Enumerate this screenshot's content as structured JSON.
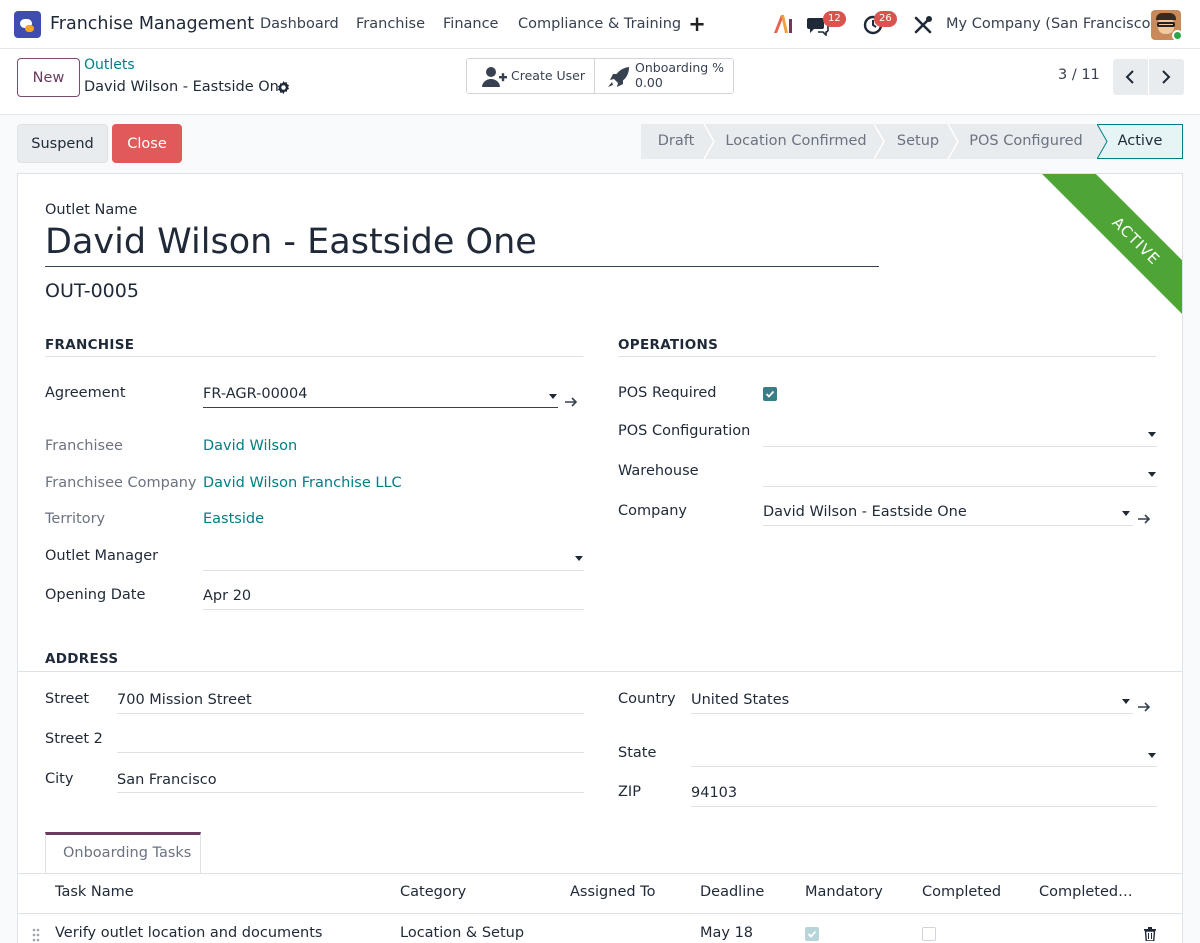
{
  "navbar": {
    "app_title": "Franchise Management",
    "menu": [
      "Dashboard",
      "Franchise",
      "Finance",
      "Compliance & Training"
    ],
    "messages_count": "12",
    "activities_count": "26",
    "company": "My Company (San Francisco)"
  },
  "control": {
    "new_label": "New",
    "breadcrumb_parent": "Outlets",
    "breadcrumb_current": "David Wilson - Eastside One",
    "create_user_label": "Create User",
    "onboarding_label": "Onboarding %",
    "onboarding_value": "0.00",
    "pager_value": "3 / 11"
  },
  "actions": {
    "suspend_label": "Suspend",
    "close_label": "Close"
  },
  "status": {
    "stages": [
      "Draft",
      "Location Confirmed",
      "Setup",
      "POS Configured",
      "Active"
    ],
    "current": "Active"
  },
  "ribbon": "ACTIVE",
  "form": {
    "outlet_name_label": "Outlet Name",
    "outlet_name": "David Wilson - Eastside One",
    "code": "OUT-0005",
    "franchise_section": "FRANCHISE",
    "operations_section": "OPERATIONS",
    "address_section": "ADDRESS",
    "agreement_label": "Agreement",
    "agreement_value": "FR-AGR-00004",
    "franchisee_label": "Franchisee",
    "franchisee_value": "David Wilson",
    "franchisee_company_label": "Franchisee Company",
    "franchisee_company_value": "David Wilson Franchise LLC",
    "territory_label": "Territory",
    "territory_value": "Eastside",
    "outlet_manager_label": "Outlet Manager",
    "outlet_manager_value": "",
    "opening_date_label": "Opening Date",
    "opening_date_value": "Apr 20",
    "pos_required_label": "POS Required",
    "pos_required": true,
    "pos_config_label": "POS Configuration",
    "pos_config_value": "",
    "warehouse_label": "Warehouse",
    "warehouse_value": "",
    "company_label": "Company",
    "company_value": "David Wilson - Eastside One",
    "street_label": "Street",
    "street_value": "700 Mission Street",
    "street2_label": "Street 2",
    "street2_value": "",
    "city_label": "City",
    "city_value": "San Francisco",
    "country_label": "Country",
    "country_value": "United States",
    "state_label": "State",
    "state_value": "",
    "zip_label": "ZIP",
    "zip_value": "94103"
  },
  "tabs": {
    "onboarding_tasks": "Onboarding Tasks"
  },
  "table": {
    "columns": [
      "Task Name",
      "Category",
      "Assigned To",
      "Deadline",
      "Mandatory",
      "Completed",
      "Completed…"
    ],
    "rows": [
      {
        "task": "Verify outlet location and documents",
        "category": "Location & Setup",
        "assigned": "",
        "deadline": "May 18",
        "mandatory": true,
        "completed": false,
        "completed_on": ""
      }
    ]
  },
  "colors": {
    "brand": "#6b3a5e",
    "link": "#017e84",
    "close_button": "#e05a5a",
    "ribbon": "#4ea536"
  }
}
